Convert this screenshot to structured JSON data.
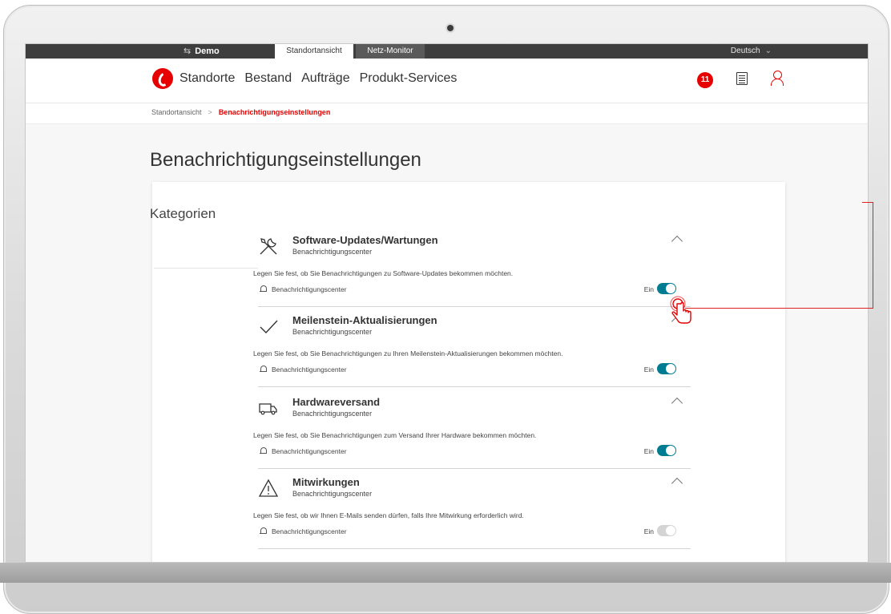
{
  "topbar": {
    "demo_label": "Demo",
    "demo_icon": "swap-arrows-icon",
    "tabs": [
      {
        "label": "Standortansicht",
        "active": true
      },
      {
        "label": "Netz-Monitor",
        "active": false
      }
    ],
    "language": "Deutsch"
  },
  "nav": {
    "items": [
      "Standorte",
      "Bestand",
      "Aufträge",
      "Produkt-Services"
    ],
    "notification_count": "11"
  },
  "breadcrumb": {
    "parent": "Standortansicht",
    "current": "Benachrichtigungseinstellungen"
  },
  "page": {
    "title": "Benachrichtigungseinstellungen",
    "categories_label": "Kategorien"
  },
  "sections": [
    {
      "icon": "tools-icon",
      "title": "Software-Updates/Wartungen",
      "subtitle": "Benachrichtigungscenter",
      "description": "Legen Sie fest, ob Sie Benachrichtigungen zu Software-Updates bekommen möchten.",
      "channel": "Benachrichtigungscenter",
      "toggle_label": "Ein",
      "enabled": true
    },
    {
      "icon": "checkmark-icon",
      "title": "Meilenstein-Aktualisierungen",
      "subtitle": "Benachrichtigungscenter",
      "description": "Legen Sie fest, ob Sie Benachrichtigungen zu Ihren Meilenstein-Aktualisierungen bekommen möchten.",
      "channel": "Benachrichtigungscenter",
      "toggle_label": "Ein",
      "enabled": true
    },
    {
      "icon": "delivery-truck-icon",
      "title": "Hardwareversand",
      "subtitle": "Benachrichtigungscenter",
      "description": "Legen Sie fest, ob Sie Benachrichtigungen zum Versand Ihrer Hardware bekommen möchten.",
      "channel": "Benachrichtigungscenter",
      "toggle_label": "Ein",
      "enabled": true
    },
    {
      "icon": "warning-icon",
      "title": "Mitwirkungen",
      "subtitle": "Benachrichtigungscenter",
      "description": "Legen Sie fest, ob wir Ihnen E-Mails senden dürfen, falls Ihre Mitwirkung erforderlich wird.",
      "channel": "Benachrichtigungscenter",
      "toggle_label": "Ein",
      "enabled": false
    }
  ],
  "colors": {
    "brand_red": "#e60000",
    "toggle_on": "#007c92",
    "toggle_off": "#d4d4d4",
    "topbar": "#3e3e3e"
  }
}
